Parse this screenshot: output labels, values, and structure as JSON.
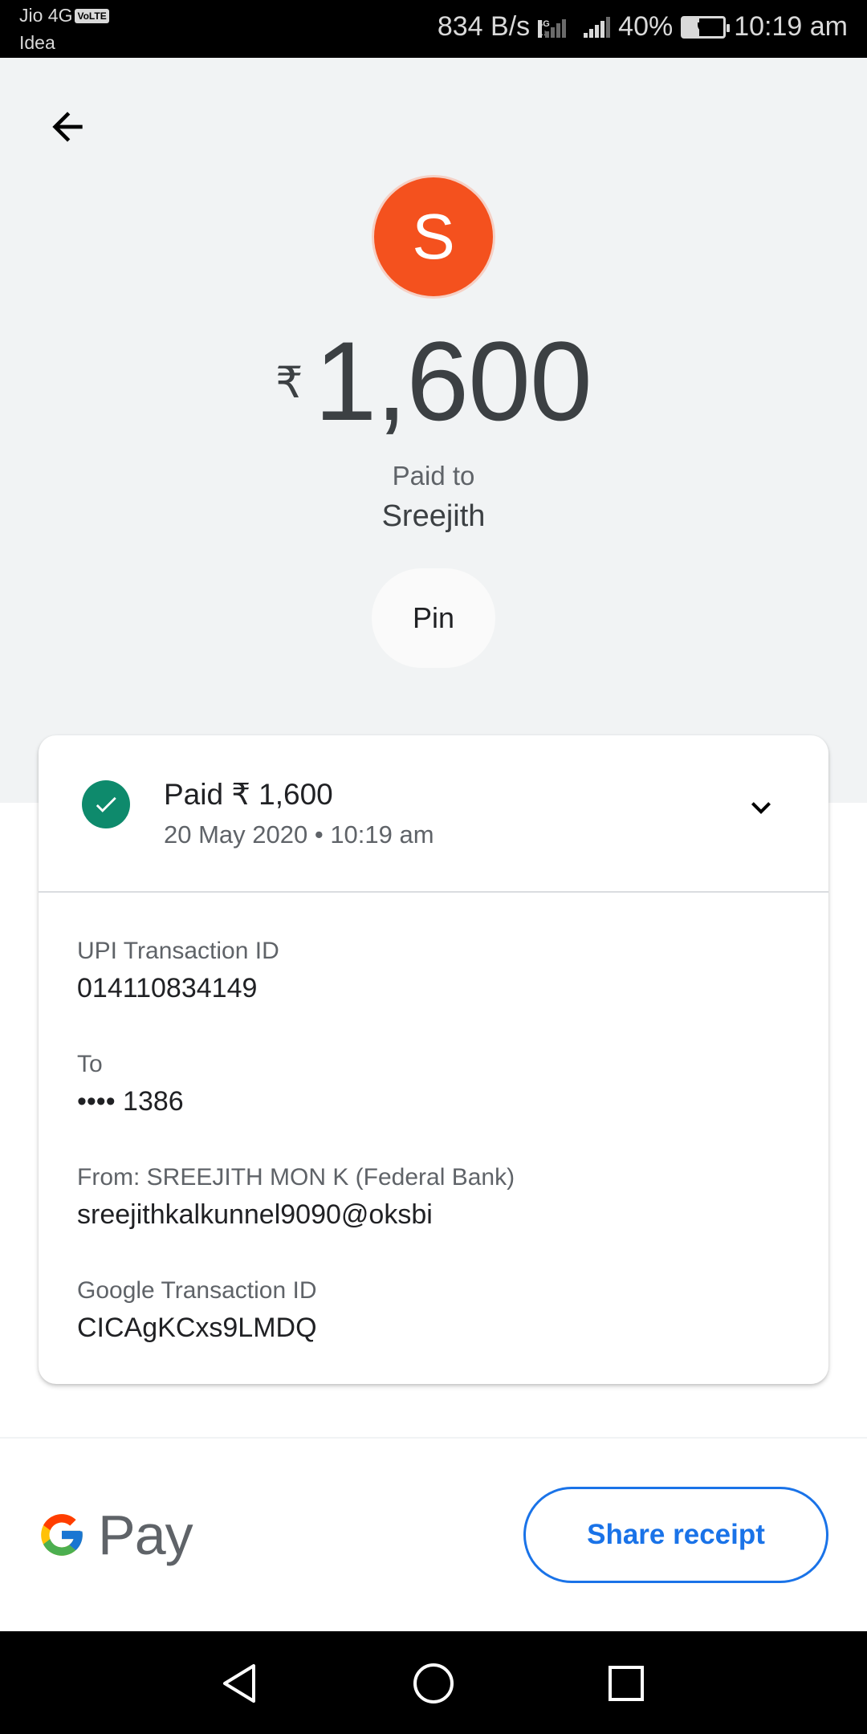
{
  "status_bar": {
    "carrier_primary": "Jio 4G",
    "volte_badge": "VoLTE",
    "carrier_secondary": "Idea",
    "net_speed": "834 B/s",
    "network_type": "4G",
    "battery_level": 0.4,
    "battery_percent": "40%",
    "time": "10:19 am"
  },
  "header": {
    "back_icon": "back-arrow-icon",
    "avatar_letter": "S",
    "avatar_color": "#f4511e",
    "currency_symbol": "₹",
    "amount": "1,600",
    "paid_to_label": "Paid to",
    "payee_name": "Sreejith",
    "pin_label": "Pin"
  },
  "transaction": {
    "status_icon": "check-circle-icon",
    "status_color": "#0e8a6c",
    "status_text": "Paid ₹ 1,600",
    "datetime": "20 May 2020 • 10:19 am",
    "expand_icon": "chevron-down-icon",
    "details": [
      {
        "label": "UPI Transaction ID",
        "value": "014110834149"
      },
      {
        "label": "To",
        "value": "•••• 1386"
      },
      {
        "label": "From: SREEJITH MON K (Federal Bank)",
        "value": "sreejithkalkunnel9090@oksbi"
      },
      {
        "label": "Google Transaction ID",
        "value": "CICAgKCxs9LMDQ"
      }
    ]
  },
  "footer": {
    "logo_text": "Pay",
    "share_label": "Share receipt",
    "accent_color": "#1a73e8"
  },
  "nav_bar": {
    "back_icon": "nav-back-icon",
    "home_icon": "nav-home-icon",
    "recents_icon": "nav-recents-icon"
  }
}
